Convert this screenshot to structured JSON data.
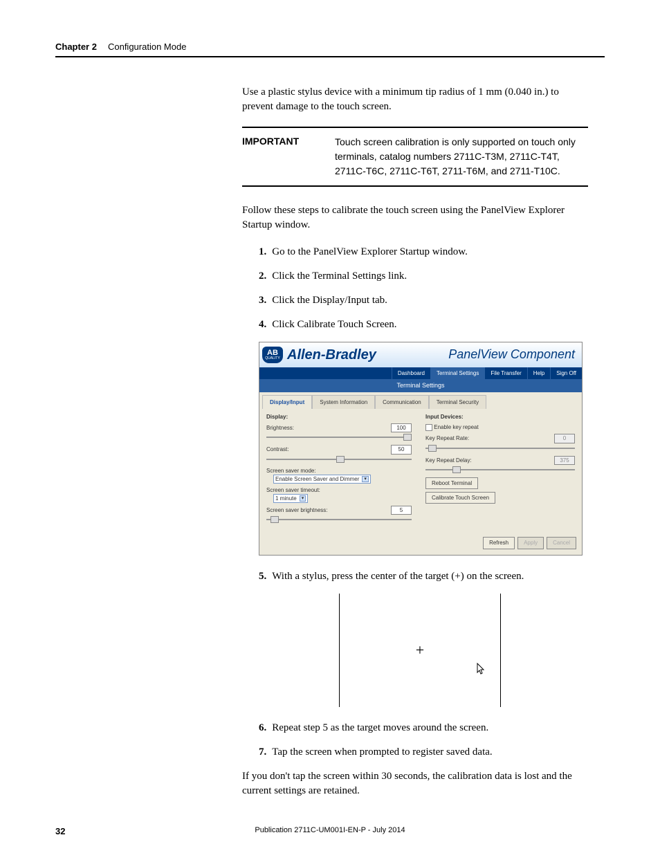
{
  "header": {
    "chapter_label": "Chapter 2",
    "chapter_title": "Configuration Mode"
  },
  "paragraphs": {
    "stylus_tip": "Use a plastic stylus device with a minimum tip radius of 1 mm (0.040 in.) to prevent damage to the touch screen.",
    "callout_label": "IMPORTANT",
    "callout_body": "Touch screen calibration is only supported on touch only terminals, catalog numbers 2711C-T3M, 2711C-T4T, 2711C-T6C, 2711C-T6T, 2711-T6M, and 2711-T10C.",
    "follow_steps": "Follow these steps to calibrate the touch screen using the PanelView Explorer Startup window.",
    "closing_1": "If you don't tap the screen within 30 seconds, the calibration data is lost and the current settings are retained."
  },
  "steps": [
    {
      "n": "1.",
      "t": "Go to the PanelView Explorer Startup window."
    },
    {
      "n": "2.",
      "t": "Click the Terminal Settings link."
    },
    {
      "n": "3.",
      "t": "Click the Display/Input tab."
    },
    {
      "n": "4.",
      "t": "Click Calibrate Touch Screen."
    },
    {
      "n": "5.",
      "t": "With a stylus, press the center of the target (+) on the screen."
    },
    {
      "n": "6.",
      "t": "Repeat step 5 as the target moves around the screen."
    },
    {
      "n": "7.",
      "t": "Tap the screen when prompted to register saved data."
    }
  ],
  "app": {
    "brand_left": "Allen-Bradley",
    "brand_right": "PanelView Component",
    "badge_text": "AB",
    "badge_sub": "QUALITY",
    "nav": {
      "dashboard": "Dashboard",
      "terminal_settings": "Terminal Settings",
      "file_transfer": "File Transfer",
      "help": "Help",
      "sign_off": "Sign Off"
    },
    "section_title": "Terminal Settings",
    "subtabs": {
      "display_input": "Display/Input",
      "system_info": "System Information",
      "communication": "Communication",
      "terminal_security": "Terminal Security"
    },
    "left": {
      "display_label": "Display:",
      "brightness_label": "Brightness:",
      "brightness_value": "100",
      "contrast_label": "Contrast:",
      "contrast_value": "50",
      "ssmode_label": "Screen saver mode:",
      "ssmode_value": "Enable Screen Saver and Dimmer",
      "sstimeout_label": "Screen saver timeout:",
      "sstimeout_value": "1 minute",
      "ssbright_label": "Screen saver brightness:",
      "ssbright_value": "5"
    },
    "right": {
      "input_devices_label": "Input Devices:",
      "enable_key_repeat": "Enable key repeat",
      "repeat_rate_label": "Key Repeat Rate:",
      "repeat_rate_value": "0",
      "repeat_delay_label": "Key Repeat Delay:",
      "repeat_delay_value": "375",
      "reboot_btn": "Reboot Terminal",
      "calibrate_btn": "Calibrate Touch Screen"
    },
    "footer_btns": {
      "refresh": "Refresh",
      "apply": "Apply",
      "cancel": "Cancel"
    }
  },
  "footer": {
    "page_number": "32",
    "pub": "Publication 2711C-UM001I-EN-P - July 2014"
  }
}
